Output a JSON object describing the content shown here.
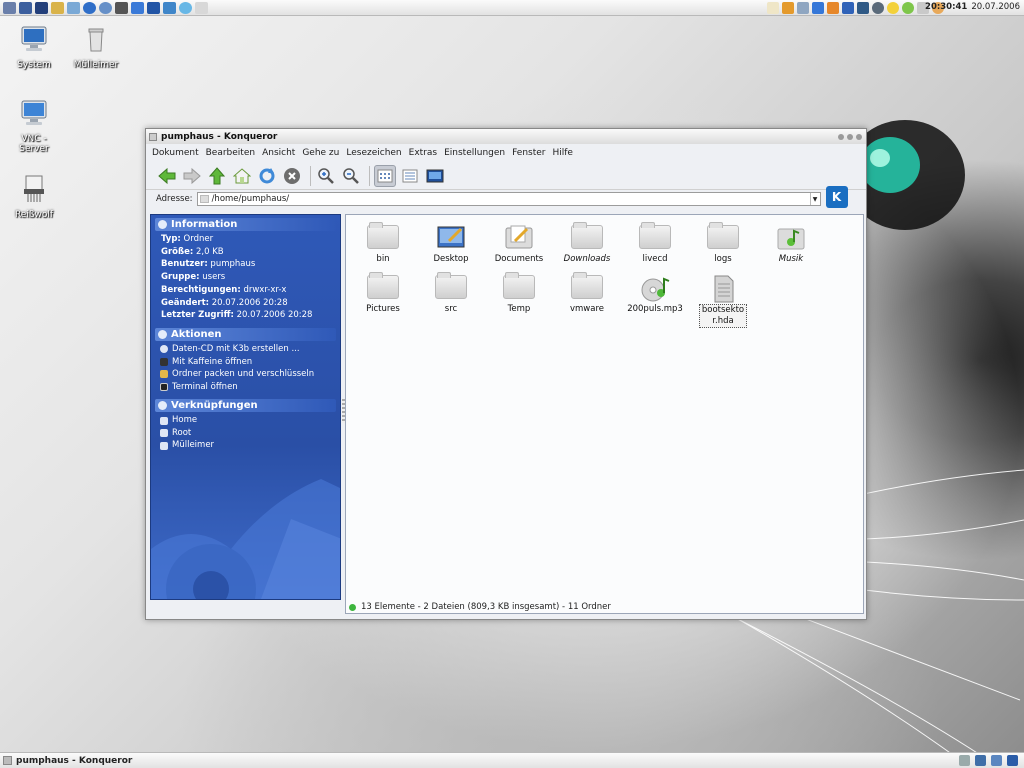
{
  "panel": {
    "clock_time": "20:30:41",
    "clock_date": "20.07.2006"
  },
  "desktop": {
    "icons": [
      {
        "label": "System"
      },
      {
        "label": "Mülleimer"
      },
      {
        "label": "VNC - Server"
      },
      {
        "label": "Reißwolf"
      }
    ]
  },
  "window": {
    "title": "pumphaus - Konqueror",
    "menu": [
      "Dokument",
      "Bearbeiten",
      "Ansicht",
      "Gehe zu",
      "Lesezeichen",
      "Extras",
      "Einstellungen",
      "Fenster",
      "Hilfe"
    ],
    "address_label": "Adresse:",
    "address_value": "/home/pumphaus/",
    "sidebar": {
      "information_title": "Information",
      "info": [
        {
          "key": "Typ:",
          "value": "Ordner"
        },
        {
          "key": "Größe:",
          "value": "2,0 KB"
        },
        {
          "key": "Benutzer:",
          "value": "pumphaus"
        },
        {
          "key": "Gruppe:",
          "value": "users"
        },
        {
          "key": "Berechtigungen:",
          "value": "drwxr-xr-x"
        },
        {
          "key": "Geändert:",
          "value": "20.07.2006 20:28"
        },
        {
          "key": "Letzter Zugriff:",
          "value": "20.07.2006 20:28"
        }
      ],
      "actions_title": "Aktionen",
      "actions": [
        "Daten-CD mit K3b erstellen ...",
        "Mit Kaffeine öffnen",
        "Ordner packen und verschlüsseln",
        "Terminal öffnen"
      ],
      "links_title": "Verknüpfungen",
      "links": [
        "Home",
        "Root",
        "Mülleimer"
      ]
    },
    "files": [
      {
        "name": "bin",
        "kind": "folder"
      },
      {
        "name": "Desktop",
        "kind": "desktop-folder"
      },
      {
        "name": "Documents",
        "kind": "documents-folder"
      },
      {
        "name": "Downloads",
        "kind": "folder",
        "italic": true
      },
      {
        "name": "livecd",
        "kind": "folder"
      },
      {
        "name": "logs",
        "kind": "folder"
      },
      {
        "name": "Musik",
        "kind": "music-folder",
        "italic": true
      },
      {
        "name": "Pictures",
        "kind": "folder"
      },
      {
        "name": "src",
        "kind": "folder"
      },
      {
        "name": "Temp",
        "kind": "folder"
      },
      {
        "name": "vmware",
        "kind": "folder"
      },
      {
        "name": "200puls.mp3",
        "kind": "audio-file"
      },
      {
        "name": "bootsektor.hda",
        "kind": "binary-file",
        "selected": true
      }
    ],
    "status": "13 Elemente - 2 Dateien (809,3 KB insgesamt) - 11 Ordner"
  },
  "taskbar": {
    "active_task": "pumphaus - Konqueror"
  }
}
